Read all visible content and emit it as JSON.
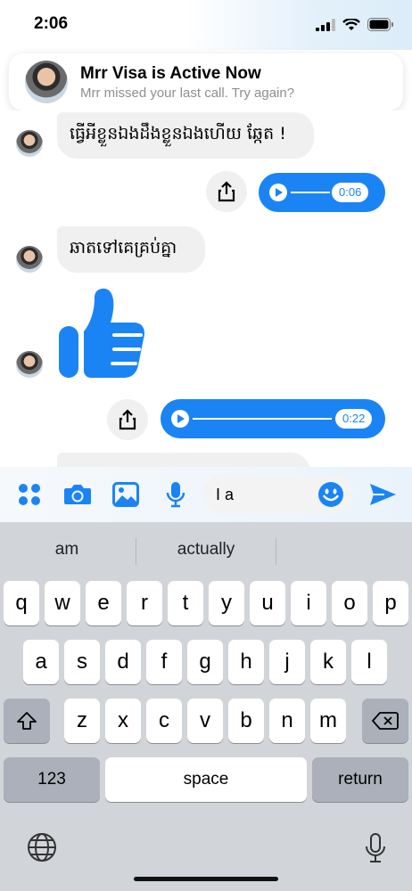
{
  "status_bar": {
    "time": "2:06",
    "icons": [
      "signal-icon",
      "wifi-icon",
      "battery-icon"
    ]
  },
  "banner": {
    "title": "Mrr Visa is Active Now",
    "subtitle": "Mrr missed your last call. Try again?"
  },
  "messages": [
    {
      "type": "text",
      "from": "them",
      "text": "ធ្វើអីខ្លួនឯងដឹងខ្លួនឯងហើយ ឆ្កែត !"
    },
    {
      "type": "voice",
      "from": "me",
      "duration": "0:06"
    },
    {
      "type": "text",
      "from": "them",
      "text": "ឆាតទៅគេគ្រប់គ្នា"
    },
    {
      "type": "like",
      "from": "them"
    },
    {
      "type": "voice",
      "from": "me",
      "duration": "0:22"
    },
    {
      "type": "text",
      "from": "them",
      "text": "..."
    }
  ],
  "composer": {
    "input_value": "I a",
    "icons": [
      "apps-grid-icon",
      "camera-icon",
      "photo-icon",
      "microphone-icon",
      "emoji-icon",
      "send-icon"
    ]
  },
  "keyboard": {
    "suggestions": [
      "am",
      "actually",
      ""
    ],
    "row1": [
      "q",
      "w",
      "e",
      "r",
      "t",
      "y",
      "u",
      "i",
      "o",
      "p"
    ],
    "row2": [
      "a",
      "s",
      "d",
      "f",
      "g",
      "h",
      "j",
      "k",
      "l"
    ],
    "row3": [
      "z",
      "x",
      "c",
      "v",
      "b",
      "n",
      "m"
    ],
    "numbers_label": "123",
    "space_label": "space",
    "return_label": "return"
  },
  "colors": {
    "accent": "#1b84f5",
    "bubble": "#f0f0f0",
    "keyboard_bg": "#d1d4d9"
  }
}
